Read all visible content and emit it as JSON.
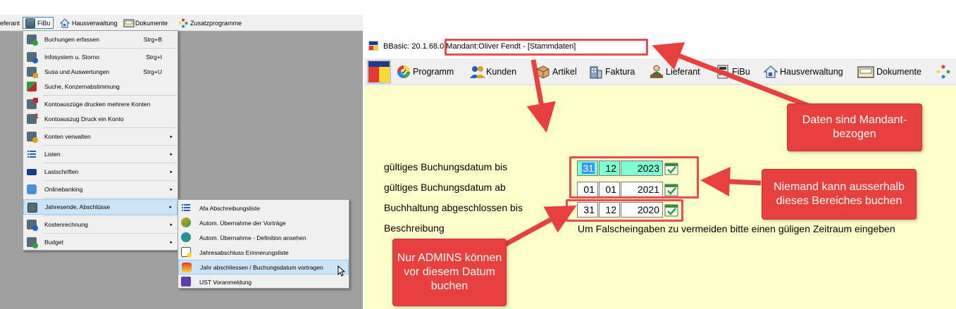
{
  "left": {
    "menubar": [
      {
        "label": "eferant",
        "icon": "none"
      },
      {
        "label": "FiBu",
        "icon": "calculator-icon",
        "active": true
      },
      {
        "label": "Hausverwaltung",
        "icon": "house-icon"
      },
      {
        "label": "Dokumente",
        "icon": "document-tray-icon"
      },
      {
        "label": "Zusatzprogramme",
        "icon": "colorful-dots-icon"
      }
    ],
    "dropdown": [
      {
        "label": "Buchungen erfassen",
        "shortcut": "Strg+B"
      },
      {
        "label": "Infosystem u. Storno",
        "shortcut": "Strg+I"
      },
      {
        "label": "Susa und Auswertungen",
        "shortcut": "Strg+U"
      },
      {
        "label": "Suche, Konzernabstimmung",
        "shortcut": ""
      },
      {
        "label": "Kontoauszüge drucken mehrere Konten",
        "shortcut": ""
      },
      {
        "label": "Kontoauszug Druck ein Konto",
        "shortcut": ""
      },
      {
        "label": "Konten verwalten",
        "shortcut": ""
      },
      {
        "label": "Listen",
        "shortcut": ""
      },
      {
        "label": "Lastschriften",
        "shortcut": ""
      },
      {
        "label": "Onlinebanking",
        "shortcut": ""
      },
      {
        "label": "Jahresende, Abschlüsse",
        "shortcut": ""
      },
      {
        "label": "Kostenrechnung",
        "shortcut": ""
      },
      {
        "label": "Budget",
        "shortcut": ""
      }
    ],
    "submenu": [
      {
        "label": "Afa Abschreibungsliste"
      },
      {
        "label": "Autom. Übernahme der Vorträge"
      },
      {
        "label": "Autom. Übernahme - Definition ansehen"
      },
      {
        "label": "Jahresabschluss Erinnerungsliste"
      },
      {
        "label": "Jahr abschliessen / Buchungsdatum vortragen"
      },
      {
        "label": "UST Voranmeldung"
      }
    ],
    "submenu_arrow": "▸"
  },
  "right": {
    "title": "BBasic: 20.1.68.0 Mandant:Oliver Fendt  - [Stammdaten]",
    "toolbar": [
      {
        "label": "Programm",
        "icon": "colorwheel-icon"
      },
      {
        "label": "Kunden",
        "icon": "people-icon"
      },
      {
        "label": "Artikel",
        "icon": "box-icon"
      },
      {
        "label": "Faktura",
        "icon": "building-icon"
      },
      {
        "label": "Lieferant",
        "icon": "person-desk-icon"
      },
      {
        "label": "FiBu",
        "icon": "calculator-icon"
      },
      {
        "label": "Hausverwaltung",
        "icon": "house-icon"
      },
      {
        "label": "Dokumente",
        "icon": "document-tray-icon"
      }
    ],
    "fields": [
      {
        "label": "gültiges Buchungsdatum bis",
        "day": "31",
        "month": "12",
        "year": "2023"
      },
      {
        "label": "gültiges Buchungsdatum ab",
        "day": "01",
        "month": "01",
        "year": "2021"
      },
      {
        "label": "Buchhaltung abgeschlossen bis",
        "day": "31",
        "month": "12",
        "year": "2020"
      }
    ],
    "beschreibung_label": "Beschreibung",
    "beschreibung_text": "Um Falscheingaben zu vermeiden bitte einen güligen Zeitraum eingeben"
  },
  "callouts": {
    "mandant": "Daten sind Mandant-bezogen",
    "niemand": "Niemand kann ausserhalb dieses Bereiches buchen",
    "admins": "Nur ADMINS können vor diesem Datum buchen"
  },
  "colors": {
    "annotation_red": "#e8403f",
    "content_bg": "#ffffcc",
    "highlight_teal": "#7fffd4",
    "menu_highlight": "#cce4f7"
  }
}
